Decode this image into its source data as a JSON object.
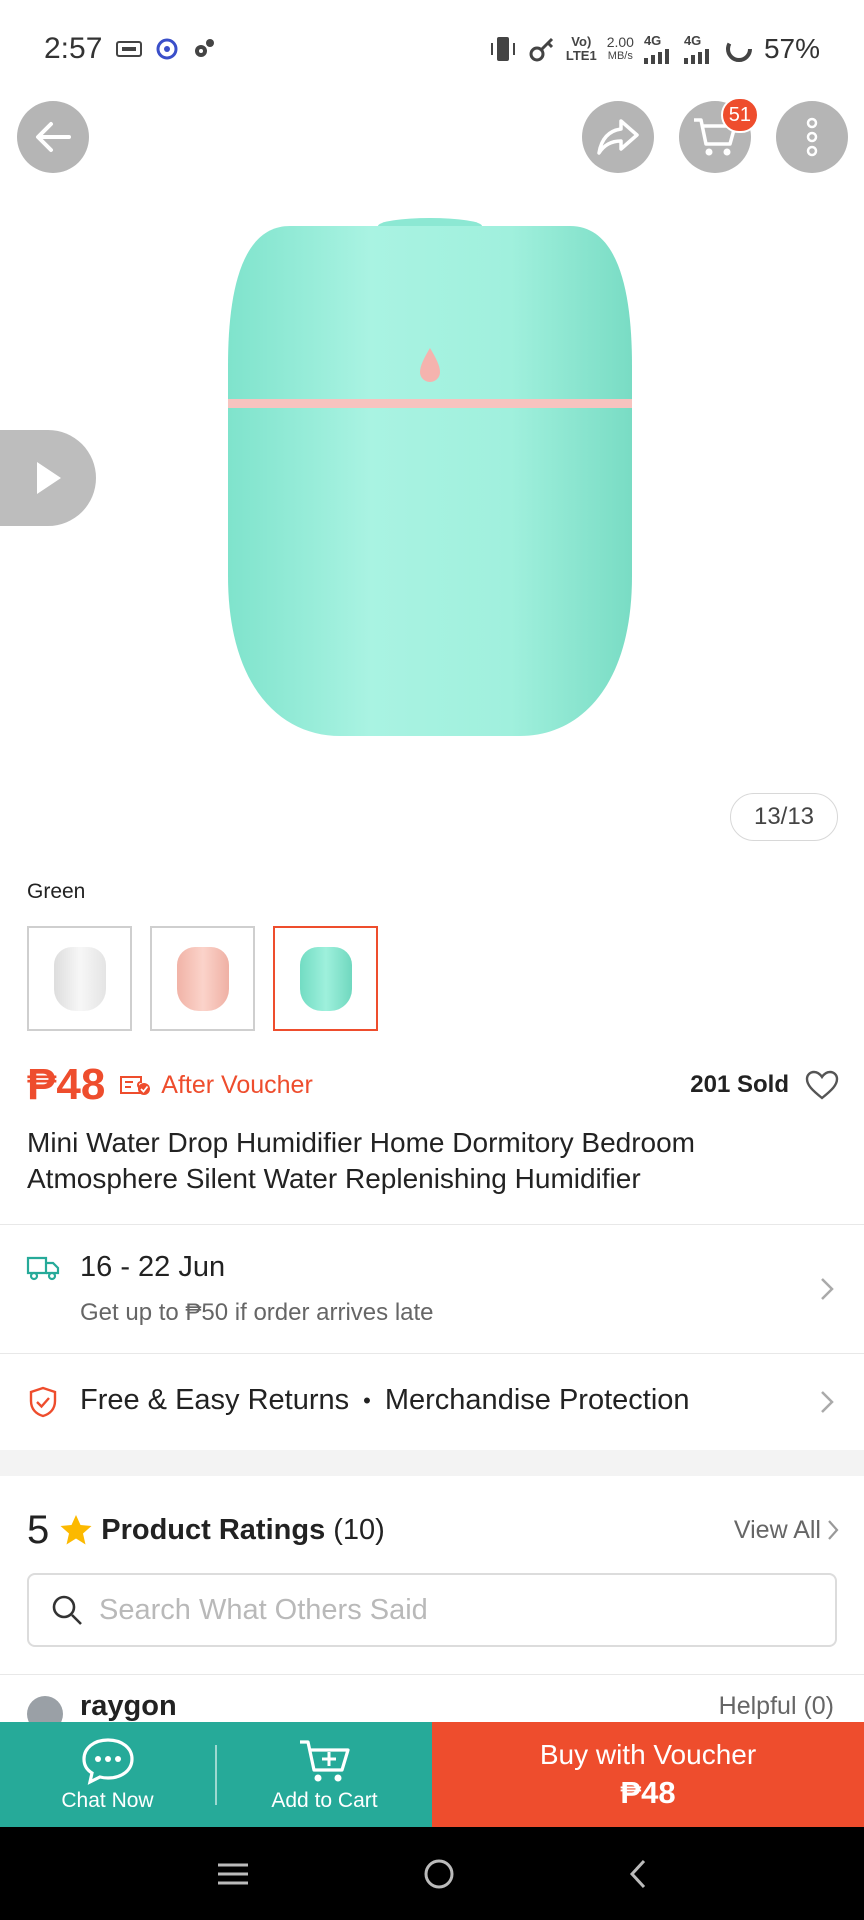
{
  "status_bar": {
    "time": "2:57",
    "net_type": "LTE1",
    "volte": "Vo)",
    "speed_value": "2.00",
    "speed_unit": "MB/s",
    "sig1": "4G",
    "sig2": "4G",
    "battery": "57%"
  },
  "header": {
    "cart_count": "51"
  },
  "gallery": {
    "counter": "13/13",
    "product_color": "#a8f0df"
  },
  "variant": {
    "selected_label": "Green",
    "options": [
      {
        "name": "white",
        "color": "#f2f2f2"
      },
      {
        "name": "pink",
        "color": "#f7c5bb"
      },
      {
        "name": "green",
        "color": "#8eecd6"
      }
    ]
  },
  "product": {
    "price": "₱48",
    "after_voucher": "After Voucher",
    "sold": "201 Sold",
    "title": "Mini Water Drop Humidifier Home Dormitory Bedroom Atmosphere Silent Water Replenishing Humidifier"
  },
  "shipping": {
    "date_range": "16 - 22 Jun",
    "late_note": "Get up to ₱50 if order arrives late"
  },
  "returns": {
    "item1": "Free & Easy Returns",
    "bullet": "•",
    "item2": "Merchandise Protection"
  },
  "ratings": {
    "score": "5",
    "title": "Product Ratings",
    "count": "(10)",
    "view_all": "View All",
    "search_placeholder": "Search What Others Said"
  },
  "review_preview": {
    "name": "raygon",
    "helpful": "Helpful (0)"
  },
  "actions": {
    "chat": "Chat Now",
    "add_to_cart": "Add to Cart",
    "buy_label": "Buy with Voucher",
    "buy_price": "₱48"
  },
  "colors": {
    "brand": "#ee4d2d",
    "teal": "#26aa99"
  }
}
